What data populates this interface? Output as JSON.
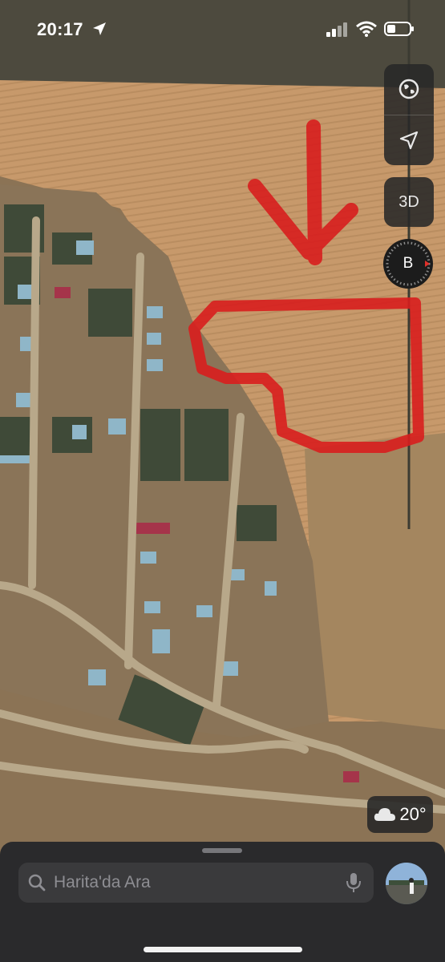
{
  "status_bar": {
    "time": "20:17"
  },
  "map_controls": {
    "three_d_label": "3D",
    "compass_label": "B"
  },
  "weather": {
    "temperature": "20°"
  },
  "search": {
    "placeholder": "Harita'da Ara"
  },
  "icons": {
    "location": "location-arrow-icon",
    "signal": "cellular-signal-icon",
    "wifi": "wifi-icon",
    "battery": "battery-icon",
    "globe": "globe-icon",
    "track": "navigation-arrow-icon",
    "cloud": "cloud-icon",
    "search": "search-icon",
    "mic": "microphone-icon"
  },
  "colors": {
    "annotation": "#d81e1e",
    "panel": "#2a2a2c"
  }
}
